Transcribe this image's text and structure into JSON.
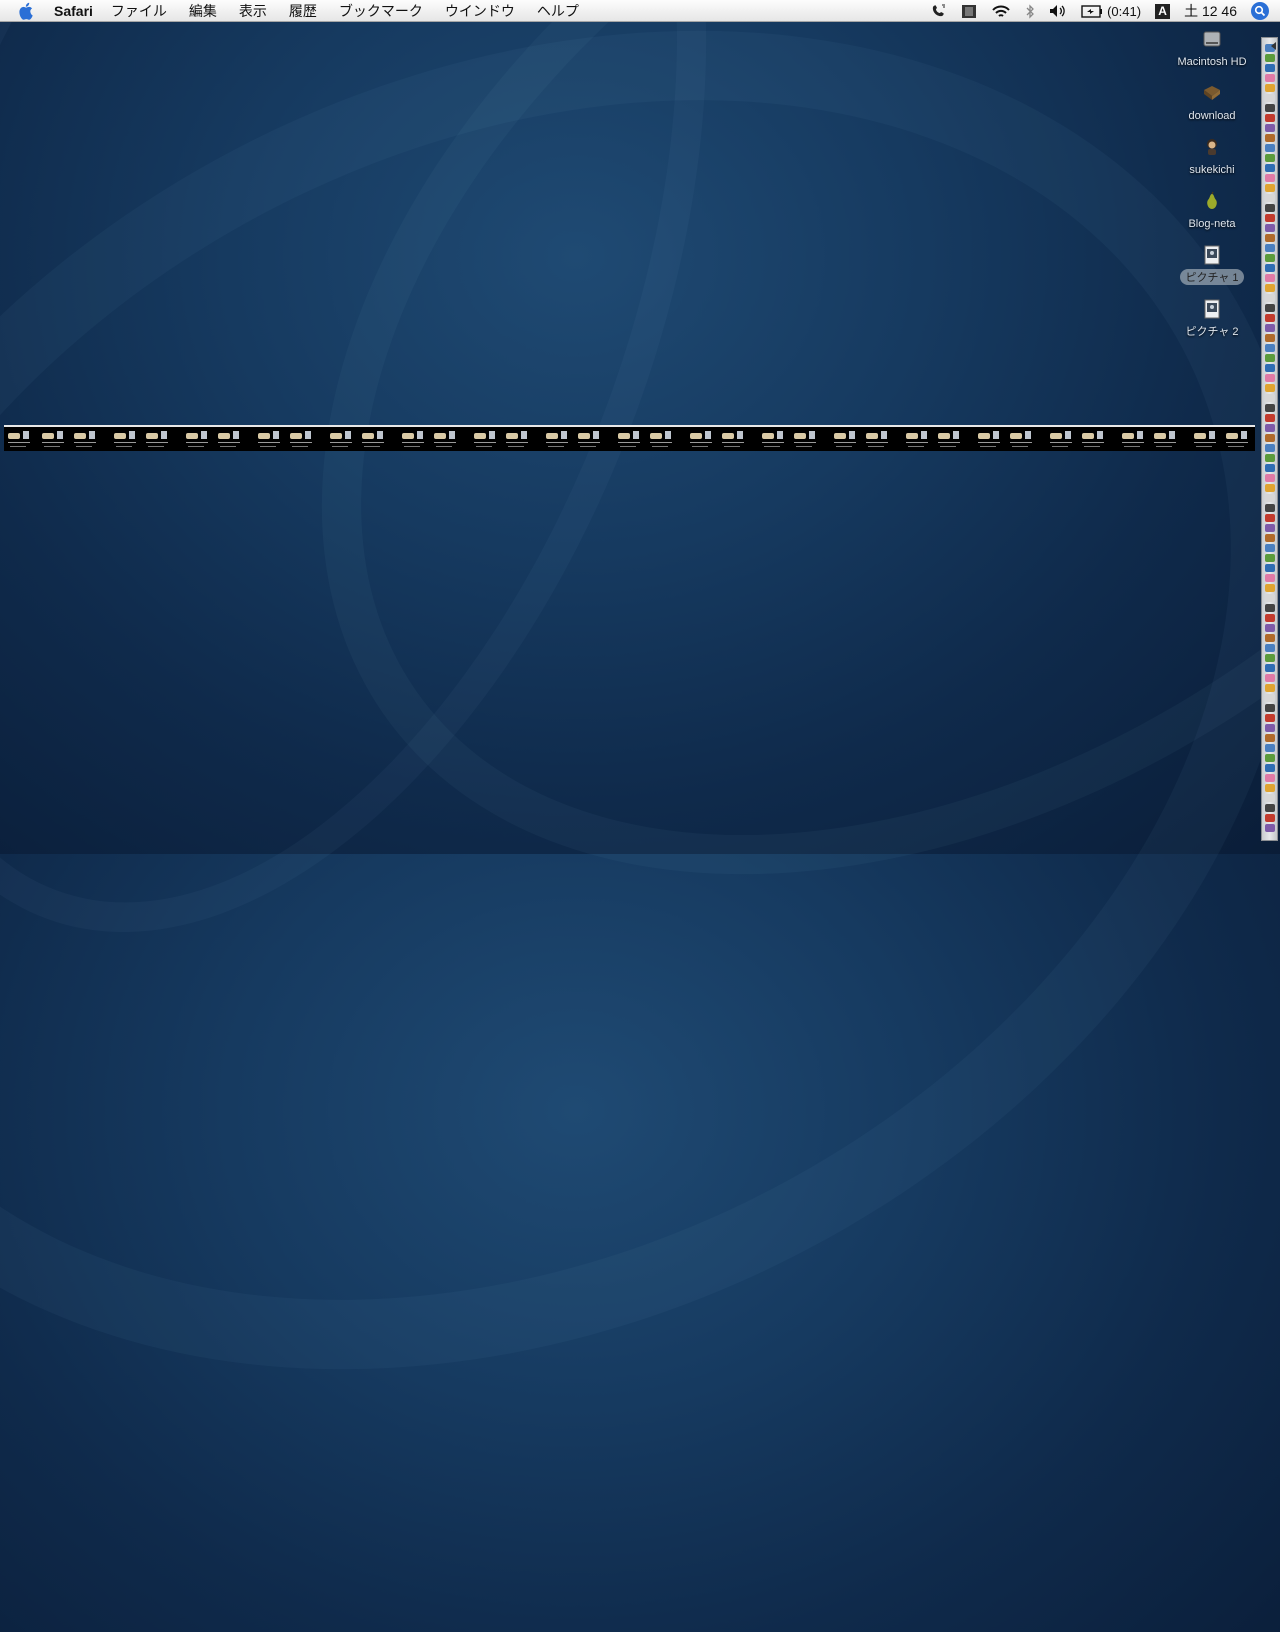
{
  "menubar": {
    "app_name": "Safari",
    "items": [
      "ファイル",
      "編集",
      "表示",
      "履歴",
      "ブックマーク",
      "ウインドウ",
      "ヘルプ"
    ],
    "battery_text": "(0:41)",
    "input_method": "A",
    "clock": "土 12 46"
  },
  "desktop": {
    "icons": [
      {
        "label": "Macintosh HD",
        "icon": "hard-drive-icon",
        "selected": false
      },
      {
        "label": "download",
        "icon": "folder-icon",
        "selected": false
      },
      {
        "label": "sukekichi",
        "icon": "character-icon",
        "selected": false
      },
      {
        "label": "Blog-neta",
        "icon": "pear-icon",
        "selected": false
      },
      {
        "label": "ピクチャ 1",
        "icon": "image-file-icon",
        "selected": true
      },
      {
        "label": "ピクチャ 2",
        "icon": "image-file-icon",
        "selected": false
      }
    ]
  },
  "colors": {
    "desktop_bg": "#163a60",
    "menubar_bg": "#f0f0f0",
    "spotlight": "#2a6fd6",
    "strip_bg": "#000000"
  }
}
